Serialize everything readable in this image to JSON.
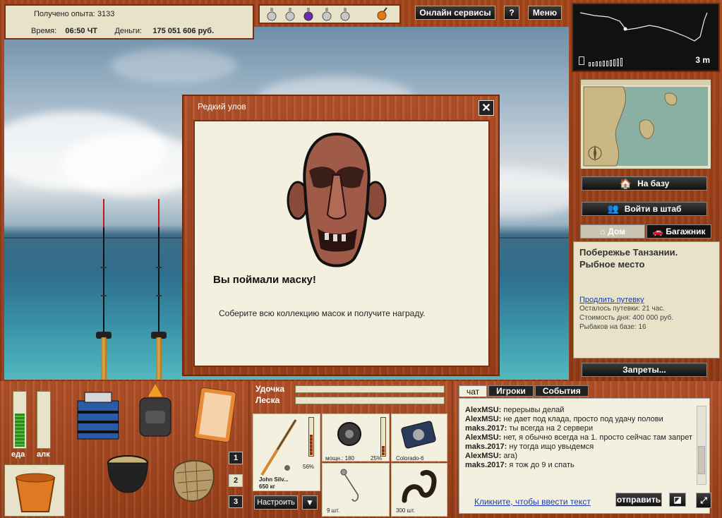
{
  "stats": {
    "xp_label": "Получено опыта:",
    "xp_value": "3133",
    "time_label": "Время:",
    "time_value": "06:50 ЧТ",
    "money_label": "Деньги:",
    "money_value": "175 051 606 руб."
  },
  "topbar": {
    "online_services": "Онлайн сервисы",
    "help": "?",
    "menu": "Меню"
  },
  "depth": {
    "value": "3 m"
  },
  "right": {
    "to_base": "На базу",
    "enter_hq": "Войти в штаб",
    "tab_home": "Дом",
    "tab_trunk": "Багажник",
    "place": "Побережье Танзании. Рыбное место",
    "extend_link": "Продлить путевку",
    "lines": [
      "Осталось путевки: 21 час.",
      "Стоимость дня: 400 000 руб.",
      "Рыбаков на базе: 16"
    ],
    "bans": "Запреты..."
  },
  "modal": {
    "title": "Редкий улов",
    "close": "✕",
    "heading": "Вы поймали маску!",
    "description": "Соберите всю коллекцию масок и получите награду."
  },
  "bottom_left": {
    "food_label": "еда",
    "alc_label": "алк",
    "food_level": 0.62,
    "alc_level": 0.0,
    "slots": [
      "1",
      "2",
      "3"
    ]
  },
  "tackle": {
    "rod_label": "Удочка",
    "line_label": "Леска",
    "rod_name": "John Silv...",
    "rod_weight": "650 кг",
    "rod_percent": "56%",
    "reel_caption": "мощн.: 180",
    "reel_percent": "25%",
    "line_caption": "Colorado-6",
    "hook_count": "9 шт.",
    "bait_count": "300 шт.",
    "setup_button": "Настроить",
    "rod_gauge_level": 0.56,
    "reel_gauge_level": 0.25
  },
  "chat": {
    "tabs": [
      "чат",
      "Игроки",
      "События"
    ],
    "messages": [
      {
        "user": "AlexMSU:",
        "text": " перерывы делай"
      },
      {
        "user": "AlexMSU:",
        "text": " не дает под клада, просто под удачу полови"
      },
      {
        "user": "maks.2017:",
        "text": " ты всегда на 2 сервери"
      },
      {
        "user": "AlexMSU:",
        "text": " нет, я обычно всегда на 1. просто сейчас там запрет"
      },
      {
        "user": "maks.2017:",
        "text": " ну тогда ищо увыдемся"
      },
      {
        "user": "AlexMSU:",
        "text": " ага)"
      },
      {
        "user": "maks.2017:",
        "text": " я тож до 9 и спать"
      }
    ],
    "input_placeholder": "Кликните, чтобы ввести текст",
    "send": "отправить"
  }
}
